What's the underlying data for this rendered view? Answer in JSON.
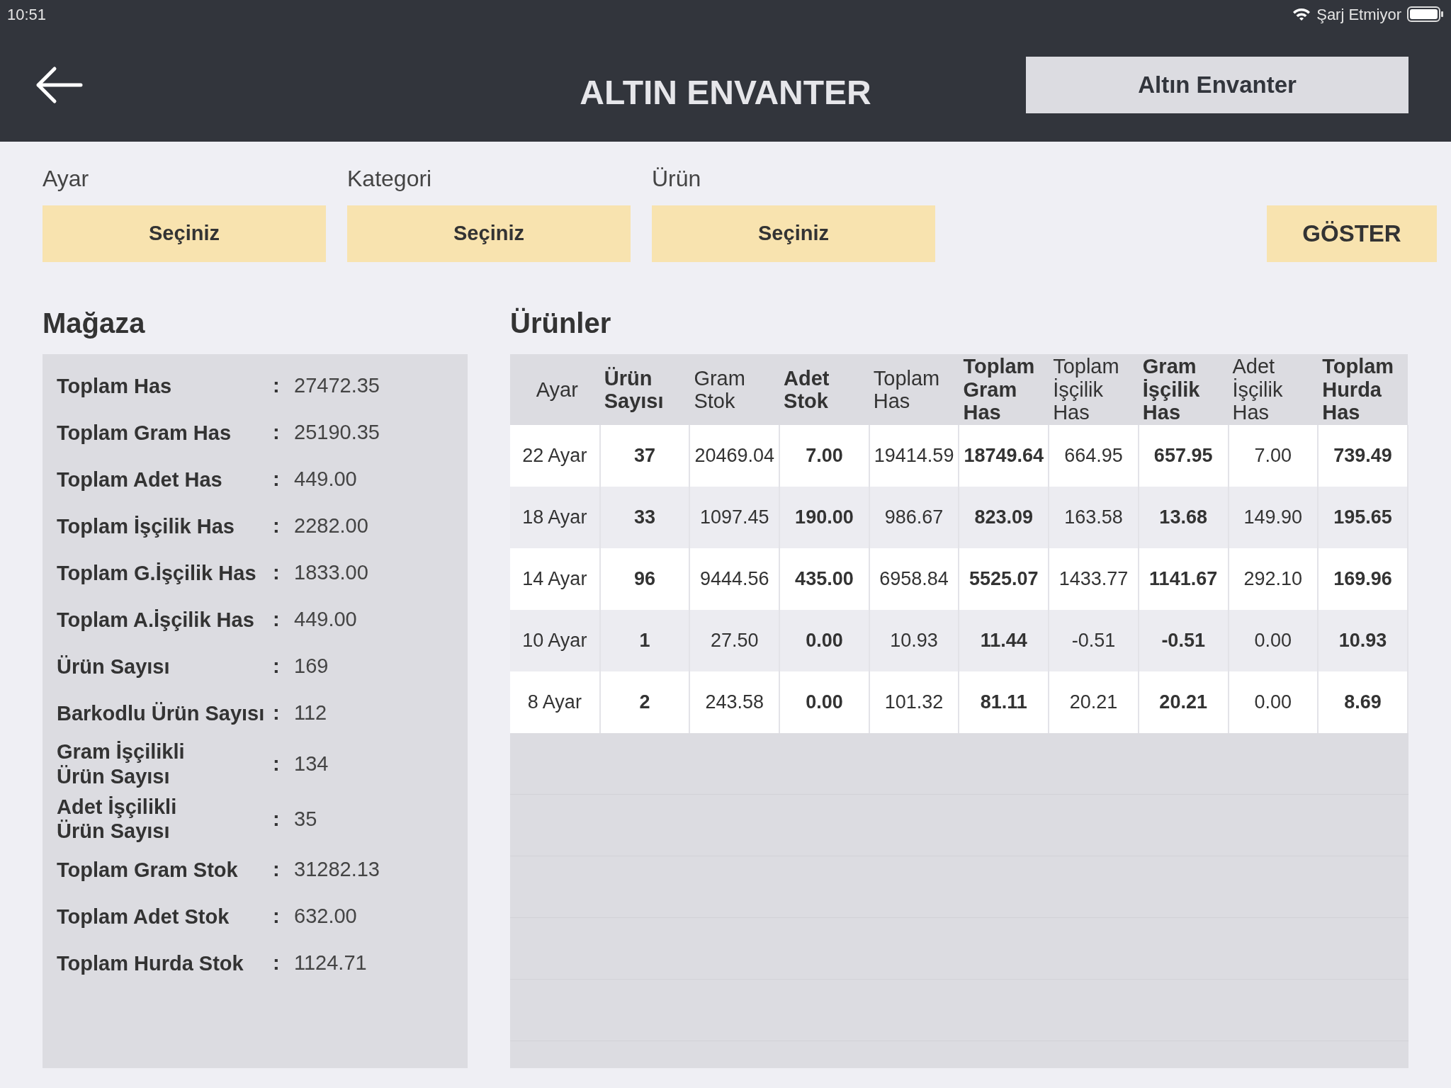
{
  "status_bar": {
    "time": "10:51",
    "charging_text": "Şarj Etmiyor"
  },
  "header": {
    "title": "ALTIN ENVANTER",
    "button": "Altın Envanter"
  },
  "filters": [
    {
      "label": "Ayar",
      "value": "Seçiniz"
    },
    {
      "label": "Kategori",
      "value": "Seçiniz"
    },
    {
      "label": "Ürün",
      "value": "Seçiniz"
    }
  ],
  "show_button": "GÖSTER",
  "store": {
    "title": "Mağaza",
    "separator": ":",
    "rows": [
      {
        "label": "Toplam Has",
        "value": "27472.35"
      },
      {
        "label": "Toplam Gram Has",
        "value": "25190.35"
      },
      {
        "label": "Toplam Adet Has",
        "value": "449.00"
      },
      {
        "label": "Toplam İşçilik Has",
        "value": "2282.00"
      },
      {
        "label": "Toplam G.İşçilik Has",
        "value": "1833.00"
      },
      {
        "label": "Toplam A.İşçilik Has",
        "value": "449.00"
      },
      {
        "label": "Ürün Sayısı",
        "value": "169"
      },
      {
        "label": "Barkodlu Ürün Sayısı",
        "value": "112"
      },
      {
        "label": "Gram İşçilikli\nÜrün Sayısı",
        "value": "134"
      },
      {
        "label": "Adet İşçilikli\nÜrün Sayısı",
        "value": "35"
      },
      {
        "label": "Toplam Gram Stok",
        "value": "31282.13"
      },
      {
        "label": "Toplam Adet Stok",
        "value": "632.00"
      },
      {
        "label": "Toplam Hurda Stok",
        "value": "1124.71"
      }
    ]
  },
  "products": {
    "title": "Ürünler",
    "columns": [
      {
        "label": "Ayar",
        "bold": false
      },
      {
        "label": "Ürün\nSayısı",
        "bold": true
      },
      {
        "label": "Gram\nStok",
        "bold": false
      },
      {
        "label": "Adet\nStok",
        "bold": true
      },
      {
        "label": "Toplam\nHas",
        "bold": false
      },
      {
        "label": "Toplam\nGram\nHas",
        "bold": true
      },
      {
        "label": "Toplam\nİşçilik\nHas",
        "bold": false
      },
      {
        "label": "Gram\nİşçilik\nHas",
        "bold": true
      },
      {
        "label": "Adet\nİşçilik\nHas",
        "bold": false
      },
      {
        "label": "Toplam\nHurda\nHas",
        "bold": true
      }
    ],
    "rows": [
      {
        "cells": [
          "22 Ayar",
          "37",
          "20469.04",
          "7.00",
          "19414.59",
          "18749.64",
          "664.95",
          "657.95",
          "7.00",
          "739.49"
        ]
      },
      {
        "cells": [
          "18 Ayar",
          "33",
          "1097.45",
          "190.00",
          "986.67",
          "823.09",
          "163.58",
          "13.68",
          "149.90",
          "195.65"
        ]
      },
      {
        "cells": [
          "14 Ayar",
          "96",
          "9444.56",
          "435.00",
          "6958.84",
          "5525.07",
          "1433.77",
          "1141.67",
          "292.10",
          "169.96"
        ]
      },
      {
        "cells": [
          "10 Ayar",
          "1",
          "27.50",
          "0.00",
          "10.93",
          "11.44",
          "-0.51",
          "-0.51",
          "0.00",
          "10.93"
        ]
      },
      {
        "cells": [
          "8 Ayar",
          "2",
          "243.58",
          "0.00",
          "101.32",
          "81.11",
          "20.21",
          "20.21",
          "0.00",
          "8.69"
        ]
      }
    ]
  }
}
